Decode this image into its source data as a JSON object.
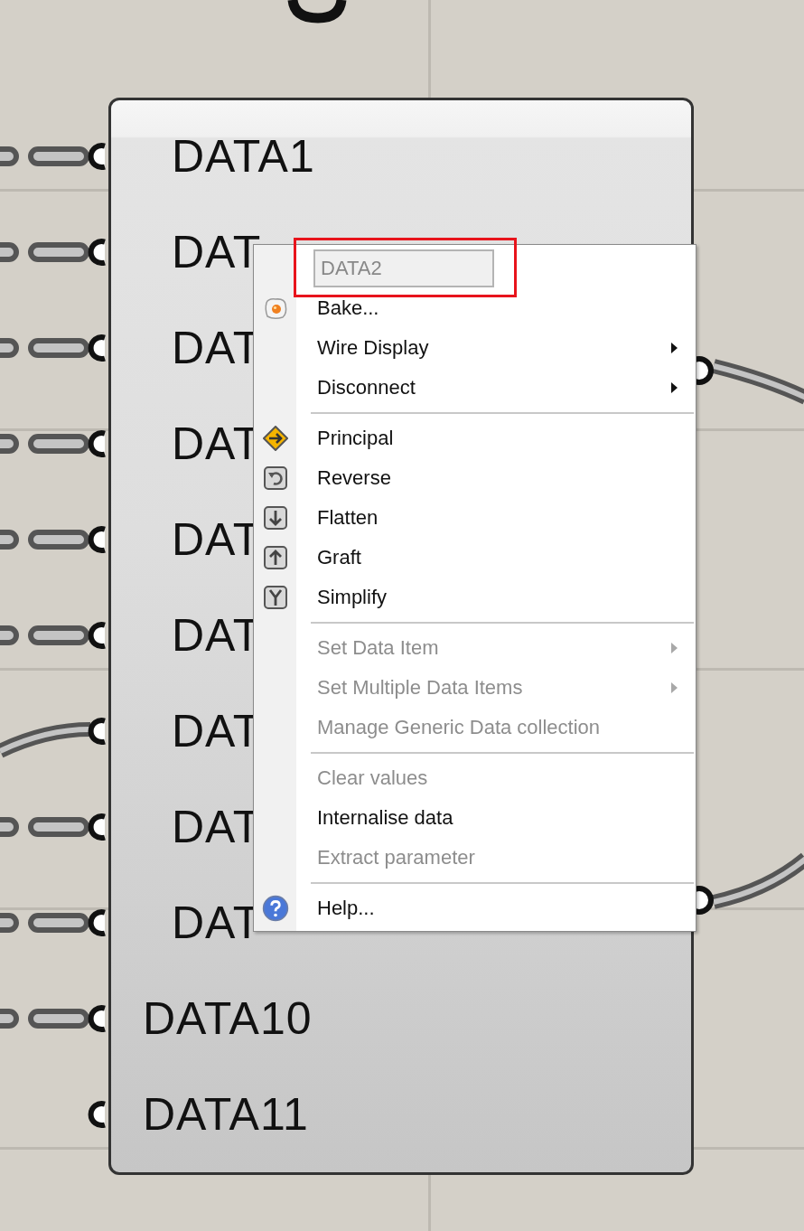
{
  "component": {
    "inputs": [
      {
        "label": "DATA1",
        "kind": "dashed"
      },
      {
        "label": "DAT",
        "kind": "dashed"
      },
      {
        "label": "DAT",
        "kind": "dashed"
      },
      {
        "label": "DAT",
        "kind": "dashed"
      },
      {
        "label": "DAT",
        "kind": "dashed"
      },
      {
        "label": "DAT",
        "kind": "dashed"
      },
      {
        "label": "DAT",
        "kind": "solid"
      },
      {
        "label": "DAT",
        "kind": "dashed"
      },
      {
        "label": "DAT",
        "kind": "dashed"
      },
      {
        "label": "DATA10",
        "kind": "dashed"
      },
      {
        "label": "DATA11",
        "kind": "none"
      }
    ]
  },
  "context_menu": {
    "name_field": {
      "value": "DATA2",
      "highlighted": true
    },
    "items": [
      {
        "kind": "item",
        "label": "Bake...",
        "enabled": true,
        "submenu": false
      },
      {
        "kind": "item",
        "label": "Wire Display",
        "enabled": true,
        "submenu": true
      },
      {
        "kind": "item",
        "label": "Disconnect",
        "enabled": true,
        "submenu": true
      },
      {
        "kind": "separator"
      },
      {
        "kind": "item",
        "label": "Principal",
        "enabled": true,
        "submenu": false
      },
      {
        "kind": "item",
        "label": "Reverse",
        "enabled": true,
        "submenu": false
      },
      {
        "kind": "item",
        "label": "Flatten",
        "enabled": true,
        "submenu": false
      },
      {
        "kind": "item",
        "label": "Graft",
        "enabled": true,
        "submenu": false
      },
      {
        "kind": "item",
        "label": "Simplify",
        "enabled": true,
        "submenu": false
      },
      {
        "kind": "separator"
      },
      {
        "kind": "item",
        "label": "Set Data Item",
        "enabled": false,
        "submenu": true
      },
      {
        "kind": "item",
        "label": "Set Multiple Data Items",
        "enabled": false,
        "submenu": true
      },
      {
        "kind": "item",
        "label": "Manage Generic Data collection",
        "enabled": false,
        "submenu": false
      },
      {
        "kind": "separator"
      },
      {
        "kind": "item",
        "label": "Clear values",
        "enabled": false,
        "submenu": false
      },
      {
        "kind": "item",
        "label": "Internalise data",
        "enabled": true,
        "submenu": false
      },
      {
        "kind": "item",
        "label": "Extract parameter",
        "enabled": false,
        "submenu": false
      },
      {
        "kind": "separator"
      },
      {
        "kind": "item",
        "label": "Help...",
        "enabled": true,
        "submenu": false
      }
    ]
  }
}
